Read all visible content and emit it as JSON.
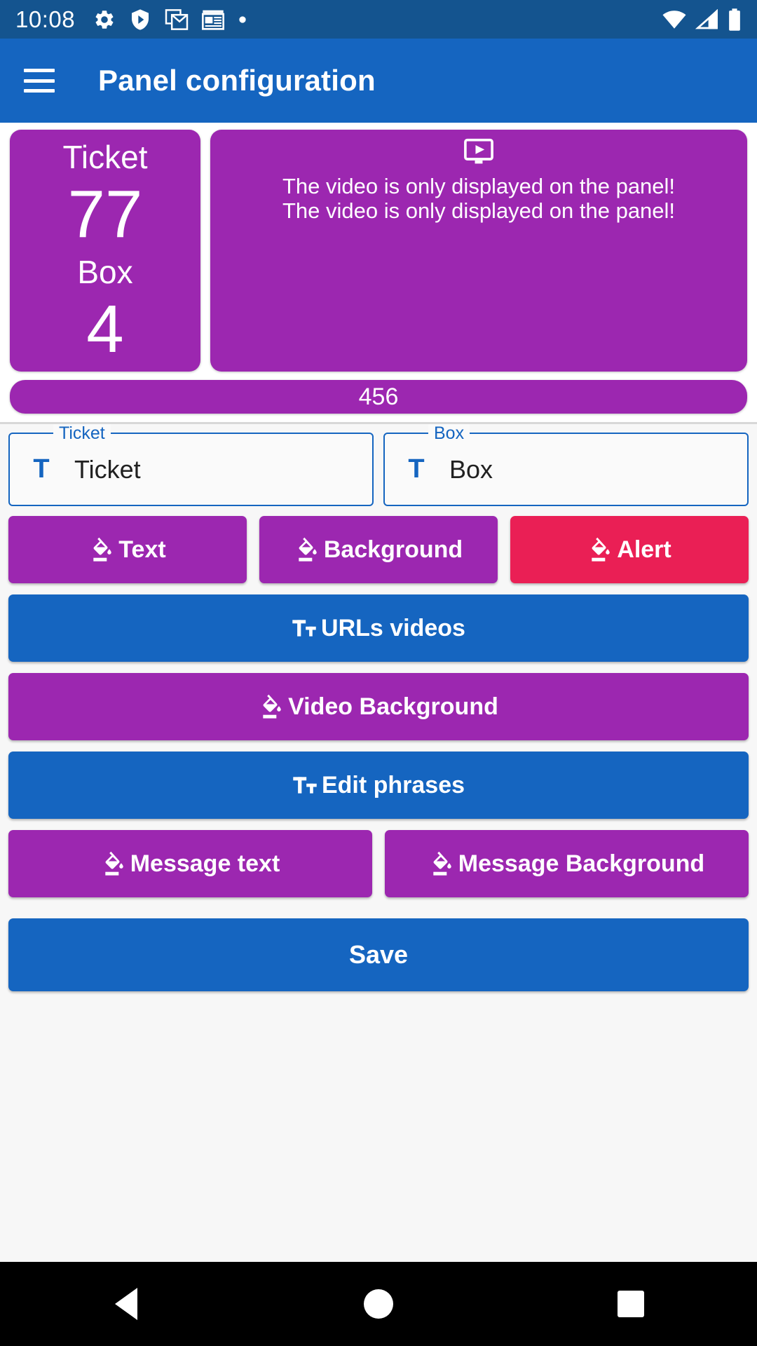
{
  "status_bar": {
    "time": "10:08",
    "left_icons": [
      "gear-icon",
      "play-protect-shield-icon",
      "gmail-icon",
      "news-calendar-icon",
      "dot-icon"
    ],
    "right_icons": [
      "wifi-icon",
      "cell-signal-icon",
      "battery-icon"
    ],
    "background": "#14548f"
  },
  "app_bar": {
    "menu_icon": "hamburger-menu-icon",
    "title": "Panel configuration",
    "background": "#1565c0"
  },
  "preview": {
    "ticket_card": {
      "ticket_label": "Ticket",
      "ticket_value": "77",
      "box_label": "Box",
      "box_value": "4",
      "background": "#9c27b0"
    },
    "video_card": {
      "icon": "ondemand-video-icon",
      "line1": "The video is only displayed on the panel!",
      "line2": "The video is only displayed on the panel!",
      "background": "#9c27b0"
    },
    "message_bar": {
      "text": "456",
      "background": "#9c27b0"
    }
  },
  "fields": [
    {
      "legend": "Ticket",
      "icon": "text-format-icon",
      "value": "Ticket"
    },
    {
      "legend": "Box",
      "icon": "text-format-icon",
      "value": "Box"
    }
  ],
  "buttons": {
    "row1": [
      {
        "label": "Text",
        "icon": "format-color-fill-icon",
        "color": "#9c27b0"
      },
      {
        "label": "Background",
        "icon": "format-color-fill-icon",
        "color": "#9c27b0"
      },
      {
        "label": "Alert",
        "icon": "format-color-fill-icon",
        "color": "#ea1f55"
      }
    ],
    "urls_videos": {
      "label": "URLs videos",
      "icon": "text-fields-icon",
      "color": "#1565c0"
    },
    "video_background": {
      "label": "Video Background",
      "icon": "format-color-fill-icon",
      "color": "#9c27b0"
    },
    "edit_phrases": {
      "label": "Edit phrases",
      "icon": "text-fields-icon",
      "color": "#1565c0"
    },
    "row_messages": [
      {
        "label": "Message text",
        "icon": "format-color-fill-icon",
        "color": "#9c27b0"
      },
      {
        "label": "Message Background",
        "icon": "format-color-fill-icon",
        "color": "#9c27b0"
      }
    ],
    "save": {
      "label": "Save",
      "color": "#1565c0"
    }
  },
  "nav_bar": {
    "back": "back-triangle-icon",
    "home": "home-circle-icon",
    "recents": "recents-square-icon"
  }
}
